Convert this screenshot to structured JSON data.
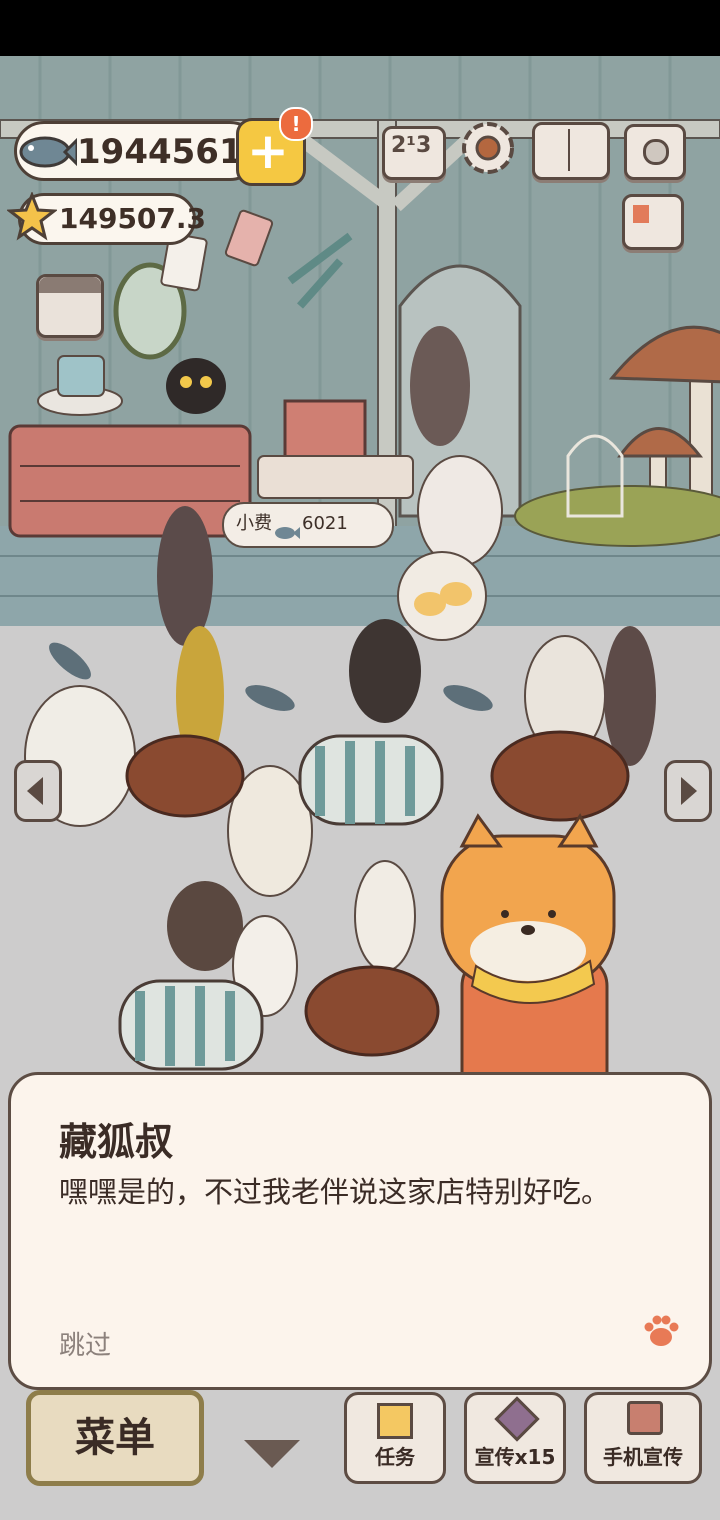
{
  "hud": {
    "fish_amount": "1944561",
    "star_amount": "149507.3",
    "plus_alert": "!"
  },
  "scene": {
    "tip_label": "小费",
    "tip_amount": "6021",
    "icons": [
      "fish-icon",
      "star-icon",
      "plus-icon",
      "ranking-icon",
      "settings-gear-icon",
      "guide-book-icon",
      "camera-icon",
      "newspaper-icon",
      "shop-icon",
      "left-arrow-icon",
      "right-arrow-icon"
    ]
  },
  "dialog": {
    "speaker": "藏狐叔",
    "line": "嘿嘿是的，不过我老伴说这家店特别好吃。",
    "skip": "跳过"
  },
  "bottom_bar": {
    "menu_label": "菜单",
    "tasks_label": "任务",
    "promote_label": "宣传x15",
    "phone_promote_label": "手机宣传"
  },
  "colors": {
    "accent_orange": "#e7784e",
    "gold": "#f3c94f",
    "wall": "#8fa5a3",
    "floor": "#cfcfcf"
  }
}
